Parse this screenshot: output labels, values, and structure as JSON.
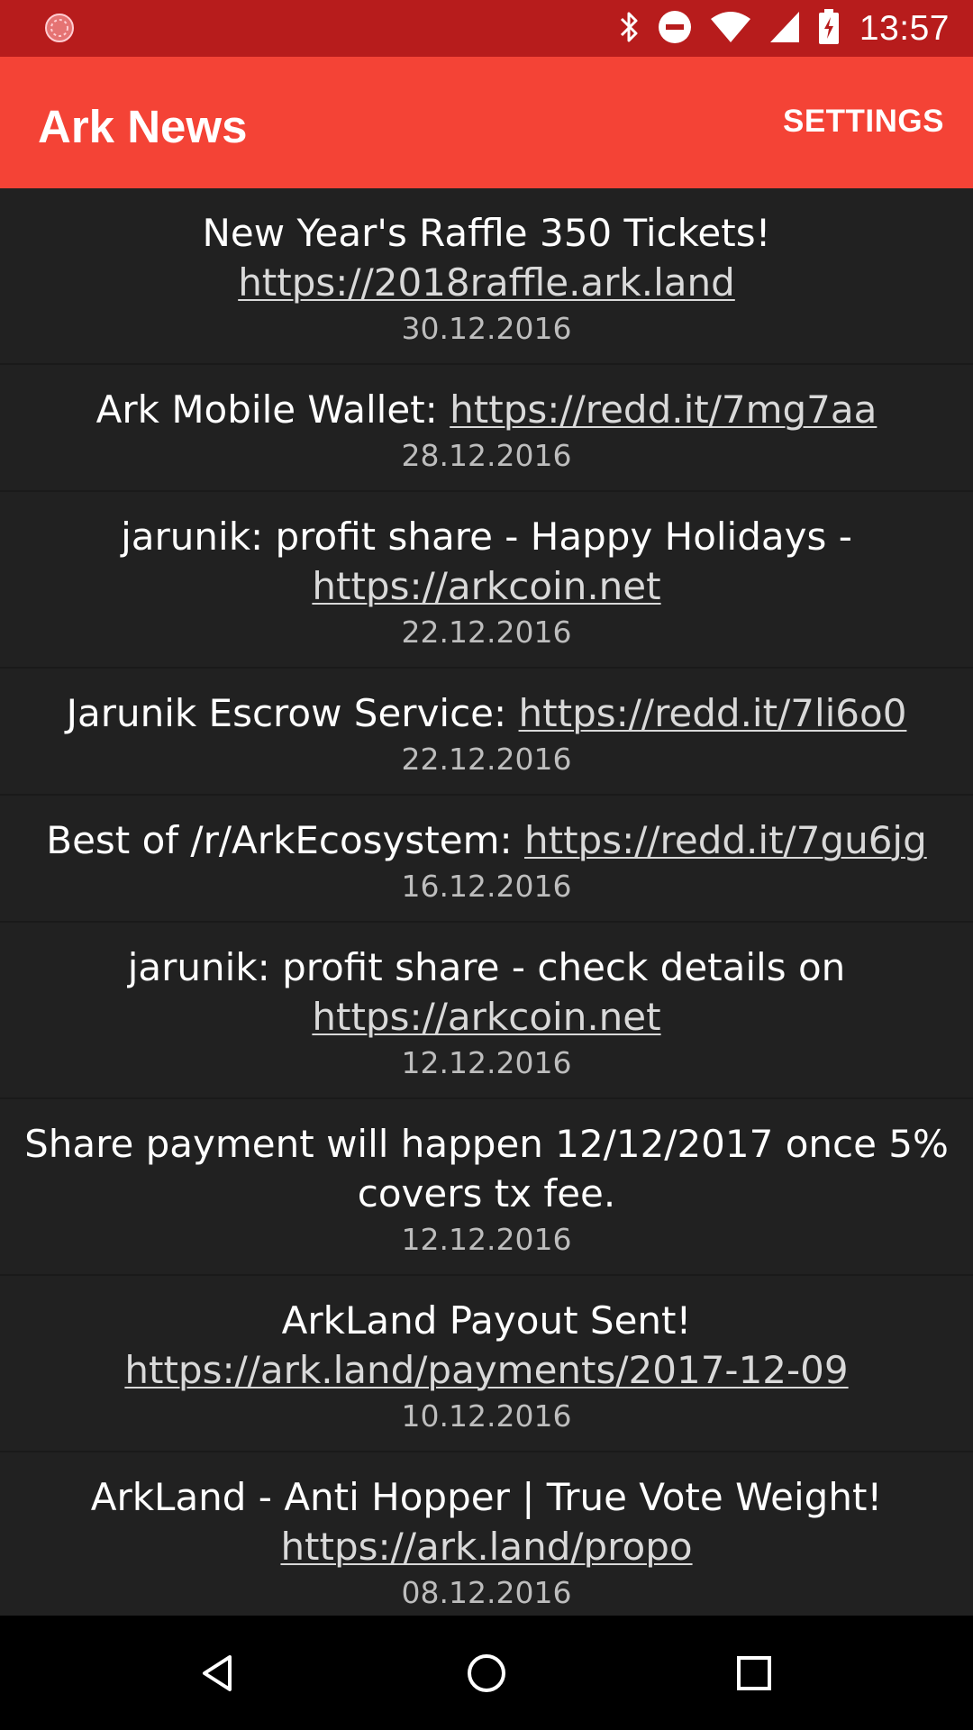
{
  "status_bar": {
    "time": "13:57",
    "icons": [
      "notification-icon",
      "bluetooth-icon",
      "do-not-disturb-icon",
      "wifi-icon",
      "signal-icon",
      "battery-charging-icon"
    ],
    "color": "#B71C1C"
  },
  "app_bar": {
    "title": "Ark News",
    "settings_label": "SETTINGS",
    "color": "#F44336"
  },
  "news": [
    {
      "text": "New Year's Raffle 350 Tickets!",
      "link": "https://2018raffle.ark.land",
      "date": "30.12.2016"
    },
    {
      "text": "Ark Mobile Wallet: ",
      "link": "https://redd.it/7mg7aa",
      "date": "28.12.2016"
    },
    {
      "text": "jarunik: profit share - Happy Holidays -",
      "link": "https://arkcoin.net",
      "date": "22.12.2016"
    },
    {
      "text": "Jarunik Escrow Service: ",
      "link": "https://redd.it/7li6o0",
      "date": "22.12.2016"
    },
    {
      "text": "Best of /r/ArkEcosystem: ",
      "link": "https://redd.it/7gu6jg",
      "date": "16.12.2016"
    },
    {
      "text": "jarunik: profit share - check details on",
      "link": "https://arkcoin.net",
      "date": "12.12.2016"
    },
    {
      "text": "Share payment will happen 12/12/2017 once 5% covers tx fee.",
      "link": "",
      "date": "12.12.2016"
    },
    {
      "text": "ArkLand Payout Sent!",
      "link": "https://ark.land/payments/2017-12-09",
      "date": "10.12.2016"
    },
    {
      "text": "ArkLand - Anti Hopper | True Vote Weight!",
      "link": "https://ark.land/propo",
      "date": "08.12.2016"
    }
  ],
  "nav_bar": {
    "buttons": [
      "back-icon",
      "home-icon",
      "recents-icon"
    ]
  }
}
